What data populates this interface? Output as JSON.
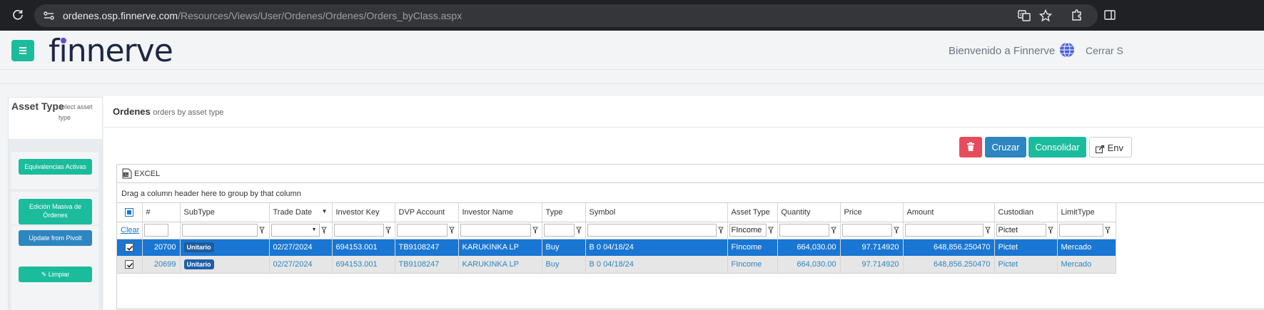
{
  "browser": {
    "url_host": "ordenes.osp.finnerve.com",
    "url_path": "/Resources/Views/User/Ordenes/Ordenes/Orders_byClass.aspx"
  },
  "header": {
    "logo": "finnerve",
    "welcome": "Bienvenido a Finnerve",
    "logout": "Cerrar S"
  },
  "sidebar": {
    "title": "Asset Type",
    "subtitle": "select asset type",
    "buttons": [
      {
        "label": "Equivalencias Activas"
      },
      {
        "label": "Edición Masiva de Órdenes"
      },
      {
        "label": "Update from Pivolt"
      },
      {
        "label": "Limpiar"
      }
    ]
  },
  "main": {
    "title": "Ordenes",
    "subtitle": "orders by asset type",
    "buttons": {
      "cruzar": "Cruzar",
      "consolidar": "Consolidar",
      "enviar": "Env"
    }
  },
  "grid": {
    "excel_label": "EXCEL",
    "group_hint": "Drag a column header here to group by that column",
    "clear_label": "Clear",
    "columns": [
      "#",
      "SubType",
      "Trade Date",
      "Investor Key",
      "DVP Account",
      "Investor Name",
      "Type",
      "Symbol",
      "Asset Type",
      "Quantity",
      "Price",
      "Amount",
      "Custodian",
      "LimitType"
    ],
    "filters": {
      "asset_type": "FIncome",
      "custodian": "Pictet"
    },
    "rows": [
      {
        "id": "20700",
        "subtype": "Unitario",
        "trade_date": "02/27/2024",
        "investor_key": "694153.001",
        "dvp_account": "TB9108247",
        "investor_name": "KARUKINKA LP",
        "type": "Buy",
        "symbol": "B 0 04/18/24",
        "asset_type": "FIncome",
        "quantity": "664,030.00",
        "price": "97.714920",
        "amount": "648,856.250470",
        "custodian": "Pictet",
        "limit_type": "Mercado"
      },
      {
        "id": "20699",
        "subtype": "Unitario",
        "trade_date": "02/27/2024",
        "investor_key": "694153.001",
        "dvp_account": "TB9108247",
        "investor_name": "KARUKINKA LP",
        "type": "Buy",
        "symbol": "B 0 04/18/24",
        "asset_type": "FIncome",
        "quantity": "664,030.00",
        "price": "97.714920",
        "amount": "648,856.250470",
        "custodian": "Pictet",
        "limit_type": "Mercado"
      }
    ]
  }
}
